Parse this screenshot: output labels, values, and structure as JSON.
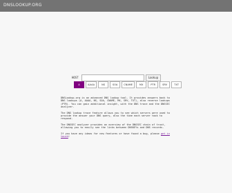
{
  "header": {
    "title": "DNSLOOKUP.ORG"
  },
  "search": {
    "label": "HOST",
    "value": "",
    "placeholder": "",
    "button_label": "Lookup"
  },
  "record_types": [
    {
      "label": "A",
      "active": true
    },
    {
      "label": "AAAA",
      "active": false
    },
    {
      "label": "NS",
      "active": false
    },
    {
      "label": "SOA",
      "active": false
    },
    {
      "label": "CNAME",
      "active": false
    },
    {
      "label": "MX",
      "active": false
    },
    {
      "label": "PTR",
      "active": false
    },
    {
      "label": "SRV",
      "active": false
    },
    {
      "label": "TXT",
      "active": false
    }
  ],
  "description": {
    "p1": "DNSLookup.org is an advanced DNS lookup tool. It provides answers back to DNS lookups (A, AAAA, NS, SOA, CNAME, MX, SRV, TXT), also reverse lookups (PTR). You can gain additional insight, with the DNS trace and the DNSSEC analyzer.",
    "p2": "The DNS lookup trace feature allows you to see which servers were used to provide the answer your DNS query, also the time each server took to respond.",
    "p3": "The DNSSEC analyzer provides an overview of the DNSSEC chain of trust, allowing you to easily see the links between DNSKEYs and DNS records.",
    "p4_prefix": "If you have any ideas for new features or have found a bug, please ",
    "p4_link": "get in touch",
    "p4_suffix": "!"
  },
  "colors": {
    "header_bg": "#737373",
    "accent": "#800080",
    "page_bg": "#f7f7f7"
  }
}
